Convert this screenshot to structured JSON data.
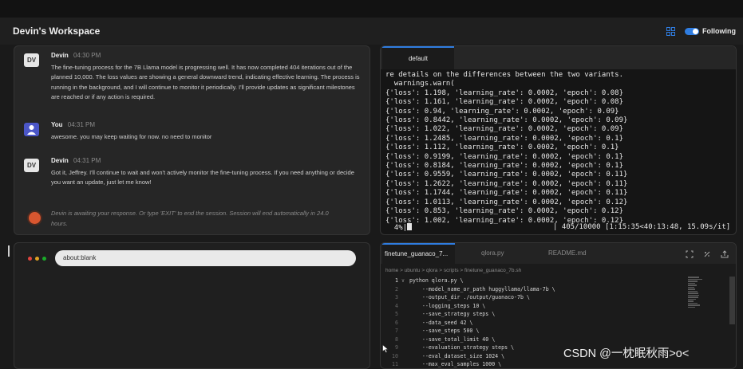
{
  "header": {
    "title": "Devin's Workspace",
    "following_label": "Following",
    "following_enabled": true,
    "accent_color": "#2f7de1"
  },
  "chat": {
    "messages": [
      {
        "avatar": "DV",
        "author": "Devin",
        "time": "04:30 PM",
        "text": "The fine-tuning process for the 7B Llama model is progressing well. It has now completed 404 iterations out of the planned 10,000. The loss values are showing a general downward trend, indicating effective learning. The process is running in the background, and I will continue to monitor it periodically. I'll provide updates as significant milestones are reached or if any action is required."
      },
      {
        "avatar": "",
        "author": "You",
        "time": "04:31 PM",
        "text": "awesome. you may keep waiting for now. no need to monitor"
      },
      {
        "avatar": "DV",
        "author": "Devin",
        "time": "04:31 PM",
        "text": "Got it, Jeffrey. I'll continue to wait and won't actively monitor the fine-tuning process. If you need anything or decide you want an update, just let me know!"
      }
    ],
    "status": "Devin is awaiting your response. Or type 'EXIT' to end the session. Session will end automatically in 24.0 hours."
  },
  "terminal": {
    "tab_label": "default",
    "lines": [
      "re details on the differences between the two variants.",
      "  warnings.warn(",
      "{'loss': 1.198, 'learning_rate': 0.0002, 'epoch': 0.08}",
      "{'loss': 1.161, 'learning_rate': 0.0002, 'epoch': 0.08}",
      "{'loss': 0.94, 'learning_rate': 0.0002, 'epoch': 0.09}",
      "{'loss': 0.8442, 'learning_rate': 0.0002, 'epoch': 0.09}",
      "{'loss': 1.022, 'learning_rate': 0.0002, 'epoch': 0.09}",
      "{'loss': 1.2485, 'learning_rate': 0.0002, 'epoch': 0.1}",
      "{'loss': 1.112, 'learning_rate': 0.0002, 'epoch': 0.1}",
      "{'loss': 0.9199, 'learning_rate': 0.0002, 'epoch': 0.1}",
      "{'loss': 0.8184, 'learning_rate': 0.0002, 'epoch': 0.1}",
      "{'loss': 0.9559, 'learning_rate': 0.0002, 'epoch': 0.11}",
      "{'loss': 1.2622, 'learning_rate': 0.0002, 'epoch': 0.11}",
      "{'loss': 1.1744, 'learning_rate': 0.0002, 'epoch': 0.11}",
      "{'loss': 1.0113, 'learning_rate': 0.0002, 'epoch': 0.12}",
      "{'loss': 0.853, 'learning_rate': 0.0002, 'epoch': 0.12}",
      "{'loss': 1.002, 'learning_rate': 0.0002, 'epoch': 0.12}"
    ],
    "progress_left": "  4%|",
    "progress_right": "| 405/10000 [1:15:35<40:13:48, 15.09s/it]"
  },
  "browser": {
    "url": "about:blank",
    "dot_colors": [
      "#e0443e",
      "#dea123",
      "#1aab29"
    ]
  },
  "editor": {
    "tabs": [
      "finetune_guanaco_7...",
      "qlora.py",
      "README.md"
    ],
    "breadcrumb": "home > ubuntu > qlora > scripts > finetune_guanaco_7b.sh",
    "lines": [
      {
        "num": "1",
        "text": "python qlora.py \\"
      },
      {
        "num": "2",
        "text": "    --model_name_or_path huggyllama/llama-7b \\"
      },
      {
        "num": "3",
        "text": "    --output_dir ./output/guanaco-7b \\"
      },
      {
        "num": "4",
        "text": "    --logging_steps 10 \\"
      },
      {
        "num": "5",
        "text": "    --save_strategy steps \\"
      },
      {
        "num": "6",
        "text": "    --data_seed 42 \\"
      },
      {
        "num": "7",
        "text": "    --save_steps 500 \\"
      },
      {
        "num": "8",
        "text": "    --save_total_limit 40 \\"
      },
      {
        "num": "9",
        "text": "    --evaluation_strategy steps \\"
      },
      {
        "num": "10",
        "text": "    --eval_dataset_size 1024 \\"
      },
      {
        "num": "11",
        "text": "    --max_eval_samples 1000 \\"
      }
    ]
  },
  "watermark": "CSDN @一枕眠秋雨>o<"
}
